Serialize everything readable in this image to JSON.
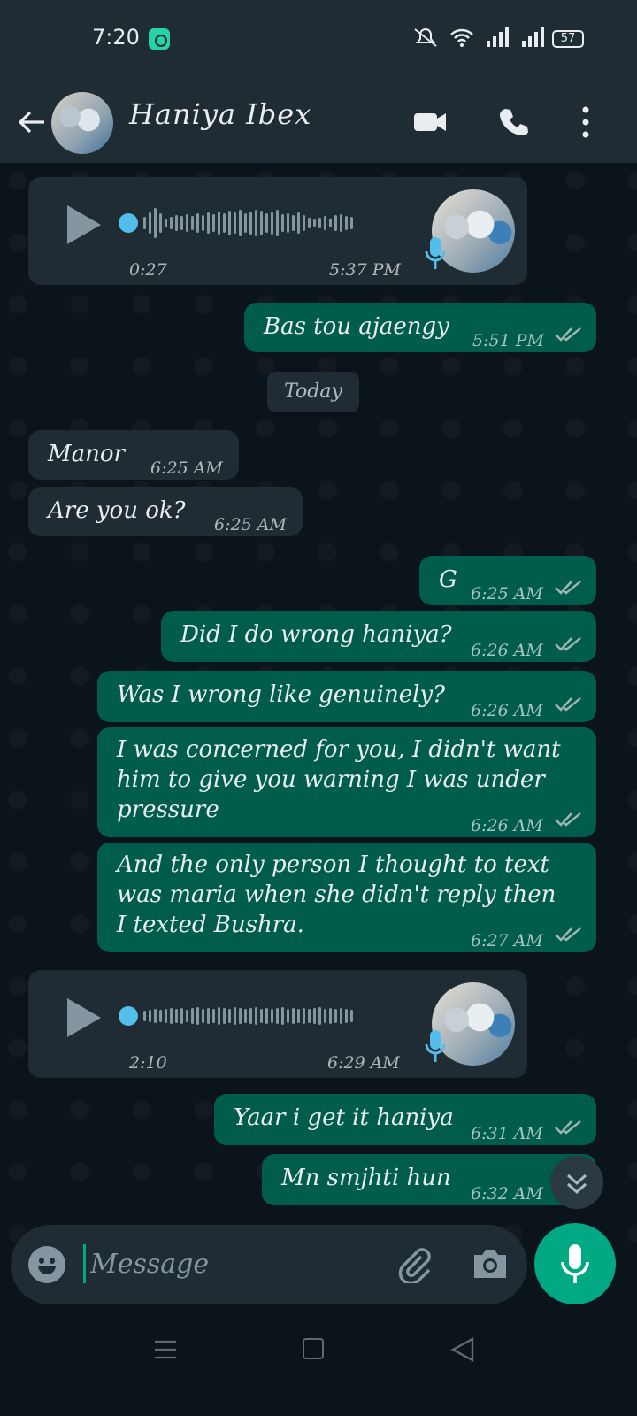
{
  "status_bar": {
    "time": "7:20",
    "battery": "57"
  },
  "header": {
    "contact_name": "Haniya Ibex"
  },
  "date_chip": "Today",
  "messages": [
    {
      "type": "voice",
      "direction": "in",
      "duration": "0:27",
      "time": "5:37 PM"
    },
    {
      "type": "text",
      "direction": "out",
      "text": "Bas tou ajaengy",
      "time": "5:51 PM"
    },
    {
      "type": "text",
      "direction": "in",
      "text": "Manor",
      "time": "6:25 AM"
    },
    {
      "type": "text",
      "direction": "in",
      "text": "Are you ok?",
      "time": "6:25 AM"
    },
    {
      "type": "text",
      "direction": "out",
      "text": "G",
      "time": "6:25 AM"
    },
    {
      "type": "text",
      "direction": "out",
      "text": "Did I do wrong haniya?",
      "time": "6:26 AM"
    },
    {
      "type": "text",
      "direction": "out",
      "text": "Was I wrong like genuinely?",
      "time": "6:26 AM"
    },
    {
      "type": "text",
      "direction": "out",
      "text_lines": [
        "I was concerned for you, I didn't want",
        "him to give you warning I was under",
        "pressure"
      ],
      "time": "6:26 AM"
    },
    {
      "type": "text",
      "direction": "out",
      "text_lines": [
        "And the only person I thought to text",
        "was maria when she didn't reply then",
        "I texted Bushra."
      ],
      "time": "6:27 AM"
    },
    {
      "type": "voice",
      "direction": "in",
      "duration": "2:10",
      "time": "6:29 AM"
    },
    {
      "type": "text",
      "direction": "out",
      "text": "Yaar i get it haniya",
      "time": "6:31 AM"
    },
    {
      "type": "text",
      "direction": "out",
      "text": "Mn smjhti hun",
      "time": "6:32 AM"
    }
  ],
  "input": {
    "placeholder": "Message"
  },
  "colors": {
    "incoming": "#1f2c34",
    "outgoing": "#005c4b",
    "accent": "#00a884",
    "read_ticks": "#9fb7b0",
    "voice_dot": "#53bdeb"
  },
  "icons": [
    "back-arrow-icon",
    "video-call-icon",
    "voice-call-icon",
    "more-options-icon",
    "play-icon",
    "microphone-icon",
    "emoji-icon",
    "attach-icon",
    "camera-icon",
    "scroll-down-icon"
  ]
}
